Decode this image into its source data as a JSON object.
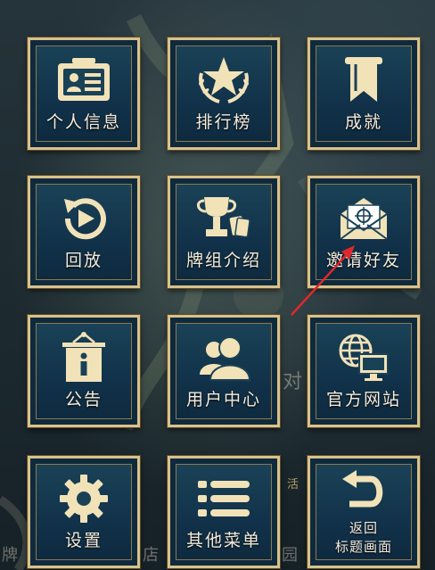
{
  "menu": {
    "items": [
      {
        "label": "个人信息",
        "icon": "profile-card-icon"
      },
      {
        "label": "排行榜",
        "icon": "ranking-star-icon"
      },
      {
        "label": "成就",
        "icon": "achievement-banner-icon"
      },
      {
        "label": "回放",
        "icon": "replay-icon"
      },
      {
        "label": "牌组介绍",
        "icon": "trophy-cards-icon"
      },
      {
        "label": "邀请好友",
        "icon": "invite-mail-icon"
      },
      {
        "label": "公告",
        "icon": "notice-board-icon"
      },
      {
        "label": "用户中心",
        "icon": "user-center-icon"
      },
      {
        "label": "官方网站",
        "icon": "official-website-icon"
      },
      {
        "label": "设置",
        "icon": "gear-icon"
      },
      {
        "label": "其他菜单",
        "icon": "menu-lines-icon"
      },
      {
        "label_line1": "返回",
        "label_line2": "标题画面",
        "icon": "return-arrow-icon"
      }
    ]
  },
  "background_text": {
    "left_char": "牌",
    "mid_char": "店",
    "right_char": "园",
    "center_char": "对",
    "top_right_badge": "活"
  },
  "annotation": {
    "arrow_color": "#e0282a",
    "points_to": "邀请好友"
  },
  "colors": {
    "tile_border": "#d9c28a",
    "tile_fill": "#11324a",
    "icon_fill": "#f2e2b8",
    "label_color": "#f4ecdc"
  }
}
